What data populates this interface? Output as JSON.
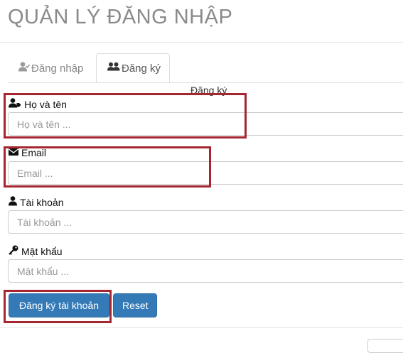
{
  "page": {
    "title": "QUẢN LÝ ĐĂNG NHẬP"
  },
  "tabs": [
    {
      "label": "Đăng nhập",
      "icon": "user-check-icon",
      "active": false
    },
    {
      "label": "Đăng ký",
      "icon": "users-icon",
      "active": true
    }
  ],
  "form": {
    "legend": "Đăng ký",
    "fields": [
      {
        "label": "Họ và tên",
        "placeholder": "Họ và tên ...",
        "icon": "user-tag-icon",
        "value": ""
      },
      {
        "label": "Email",
        "placeholder": "Email ...",
        "icon": "envelope-icon",
        "value": ""
      },
      {
        "label": "Tài khoản",
        "placeholder": "Tài khoản ...",
        "icon": "user-icon",
        "value": ""
      },
      {
        "label": "Mật khẩu",
        "placeholder": "Mật khẩu ...",
        "icon": "key-icon",
        "value": ""
      }
    ],
    "submit_label": "Đăng ký tài khoản",
    "reset_label": "Reset"
  },
  "colors": {
    "primary": "#337ab7",
    "highlight": "#a52630",
    "title": "#8a8a8a"
  }
}
